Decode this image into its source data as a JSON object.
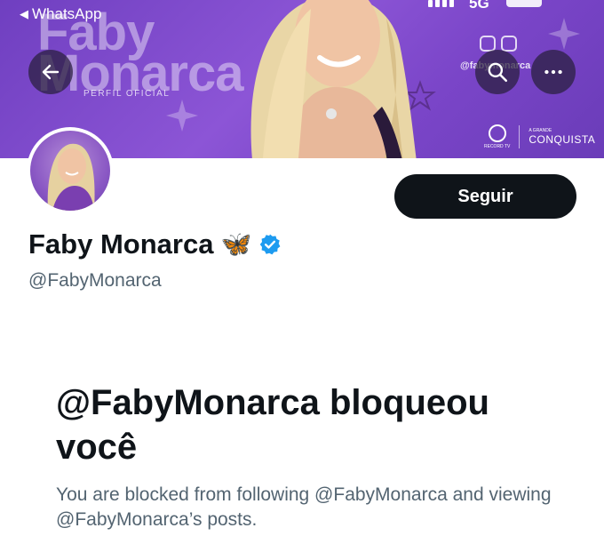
{
  "status_bar": {
    "back_app_label": "WhatsApp",
    "network": "5G"
  },
  "banner": {
    "brand_title_line1": "Faby",
    "brand_title_line2": "Monarca",
    "brand_subtitle": "PERFIL OFICIAL",
    "social_handle": "@fabymonarca",
    "logo_right_small": "A GRANDE",
    "logo_right": "CONQUISTA",
    "logo_left": "RECORD TV"
  },
  "profile": {
    "display_name": "Faby Monarca",
    "emoji": "🦋",
    "username": "@FabyMonarca",
    "follow_label": "Seguir",
    "verified_color": "#1d9bf0"
  },
  "blocked": {
    "title": "@FabyMonarca bloqueou você",
    "description": "You are blocked from following @FabyMonarca and viewing @FabyMonarca’s posts."
  },
  "colors": {
    "text_primary": "#0f1419",
    "text_secondary": "#536471",
    "banner_purple": "#7a45c8"
  },
  "icons": [
    "back-arrow-icon",
    "search-icon",
    "more-icon",
    "verified-badge-icon",
    "twitter-icon",
    "instagram-icon"
  ]
}
